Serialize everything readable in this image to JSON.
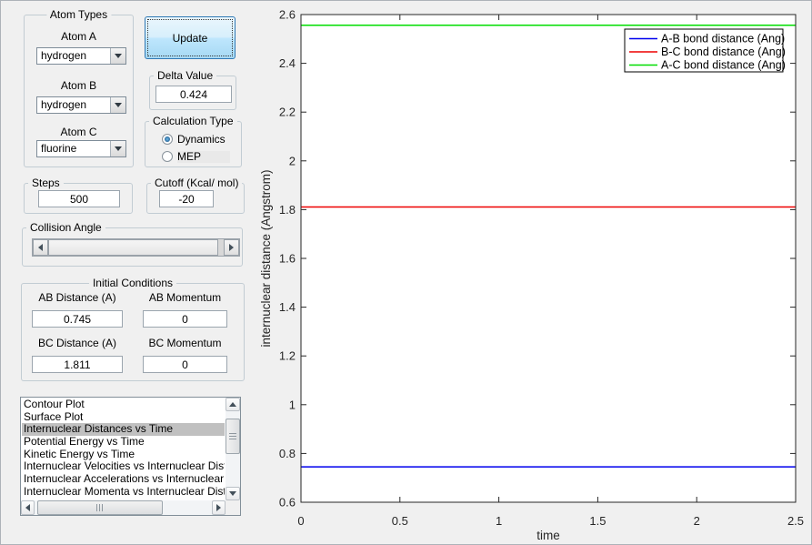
{
  "controls": {
    "atom_types": {
      "title": "Atom Types",
      "atoms": [
        {
          "label": "Atom A",
          "value": "hydrogen"
        },
        {
          "label": "Atom B",
          "value": "hydrogen"
        },
        {
          "label": "Atom C",
          "value": "fluorine"
        }
      ]
    },
    "update_button": "Update",
    "delta_value": {
      "title": "Delta Value",
      "value": "0.424"
    },
    "calculation_type": {
      "title": "Calculation Type",
      "options": [
        {
          "label": "Dynamics",
          "selected": true
        },
        {
          "label": "MEP",
          "selected": false
        }
      ]
    },
    "steps": {
      "title": "Steps",
      "value": "500"
    },
    "cutoff": {
      "title": "Cutoff (Kcal/ mol)",
      "value": "-20"
    },
    "collision_angle": {
      "title": "Collision Angle"
    },
    "initial_conditions": {
      "title": "Initial Conditions",
      "ab_distance": {
        "label": "AB Distance (A)",
        "value": "0.745"
      },
      "ab_momentum": {
        "label": "AB Momentum",
        "value": "0"
      },
      "bc_distance": {
        "label": "BC Distance (A)",
        "value": "1.811"
      },
      "bc_momentum": {
        "label": "BC Momentum",
        "value": "0"
      }
    },
    "plot_list": {
      "items": [
        "Contour Plot",
        "Surface Plot",
        "Internuclear Distances vs Time",
        "Potential Energy vs Time",
        "Kinetic Energy vs Time",
        "Internuclear Velocities vs Internuclear Distance",
        "Internuclear Accelerations vs Internuclear Dista",
        "Internuclear Momenta vs Internuclear Distance"
      ],
      "selected_index": 2
    }
  },
  "chart_data": {
    "type": "line",
    "title": "",
    "xlabel": "time",
    "ylabel": "internuclear distance (Angstrom)",
    "xlim": [
      0,
      2.5
    ],
    "ylim": [
      0.6,
      2.6
    ],
    "xticks": [
      0,
      0.5,
      1,
      1.5,
      2,
      2.5
    ],
    "yticks": [
      0.6,
      0.8,
      1,
      1.2,
      1.4,
      1.6,
      1.8,
      2,
      2.2,
      2.4,
      2.6
    ],
    "grid": false,
    "legend_position": "top-right",
    "axis_color": "#262626",
    "plot_bg": "#ffffff",
    "series": [
      {
        "name": "A-B bond distance (Ang)",
        "color": "#0000ee",
        "x": [
          0,
          2.5
        ],
        "y": [
          0.745,
          0.745
        ]
      },
      {
        "name": "B-C bond distance (Ang)",
        "color": "#ee0000",
        "x": [
          0,
          2.5
        ],
        "y": [
          1.811,
          1.811
        ]
      },
      {
        "name": "A-C bond distance (Ang)",
        "color": "#00dd00",
        "x": [
          0,
          2.5
        ],
        "y": [
          2.556,
          2.556
        ]
      }
    ]
  }
}
